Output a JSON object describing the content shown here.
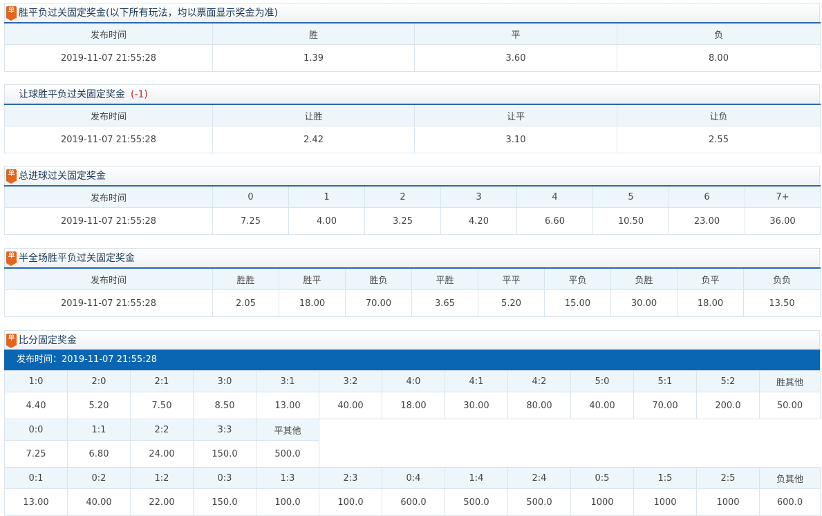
{
  "sections": {
    "had": {
      "title": "胜平负过关固定奖金(以下所有玩法，均以票面显示奖金为准)",
      "headers": [
        "发布时间",
        "胜",
        "平",
        "负"
      ],
      "values": [
        "2019-11-07 21:55:28",
        "1.39",
        "3.60",
        "8.00"
      ]
    },
    "hhad": {
      "title": "让球胜平负过关固定奖金",
      "handicap": "(-1)",
      "headers": [
        "发布时间",
        "让胜",
        "让平",
        "让负"
      ],
      "values": [
        "2019-11-07 21:55:28",
        "2.42",
        "3.10",
        "2.55"
      ]
    },
    "ttg": {
      "title": "总进球过关固定奖金",
      "headers": [
        "发布时间",
        "0",
        "1",
        "2",
        "3",
        "4",
        "5",
        "6",
        "7+"
      ],
      "values": [
        "2019-11-07 21:55:28",
        "7.25",
        "4.00",
        "3.25",
        "4.20",
        "6.60",
        "10.50",
        "23.00",
        "36.00"
      ]
    },
    "hafu": {
      "title": "半全场胜平负过关固定奖金",
      "headers": [
        "发布时间",
        "胜胜",
        "胜平",
        "胜负",
        "平胜",
        "平平",
        "平负",
        "负胜",
        "负平",
        "负负"
      ],
      "values": [
        "2019-11-07 21:55:28",
        "2.05",
        "18.00",
        "70.00",
        "3.65",
        "5.20",
        "15.00",
        "30.00",
        "18.00",
        "13.50"
      ]
    },
    "crs": {
      "title": "比分固定奖金",
      "publish_label": "发布时间：2019-11-07 21:55:28",
      "win": {
        "headers": [
          "1:0",
          "2:0",
          "2:1",
          "3:0",
          "3:1",
          "3:2",
          "4:0",
          "4:1",
          "4:2",
          "5:0",
          "5:1",
          "5:2",
          "胜其他"
        ],
        "values": [
          "4.40",
          "5.20",
          "7.50",
          "8.50",
          "13.00",
          "40.00",
          "18.00",
          "30.00",
          "80.00",
          "40.00",
          "70.00",
          "200.0",
          "50.00"
        ]
      },
      "draw": {
        "headers": [
          "0:0",
          "1:1",
          "2:2",
          "3:3",
          "平其他"
        ],
        "values": [
          "7.25",
          "6.80",
          "24.00",
          "150.0",
          "500.0"
        ]
      },
      "lose": {
        "headers": [
          "0:1",
          "0:2",
          "1:2",
          "0:3",
          "1:3",
          "2:3",
          "0:4",
          "1:4",
          "2:4",
          "0:5",
          "1:5",
          "2:5",
          "负其他"
        ],
        "values": [
          "13.00",
          "40.00",
          "22.00",
          "150.0",
          "100.0",
          "100.0",
          "600.0",
          "500.0",
          "500.0",
          "1000",
          "1000",
          "1000",
          "600.0"
        ]
      }
    }
  },
  "badge_label": "单",
  "colors": {
    "accent": "#0a66b3",
    "badge": "#e2651d",
    "handicap": "#c81f1f",
    "header_bg": "#edf6fb"
  }
}
